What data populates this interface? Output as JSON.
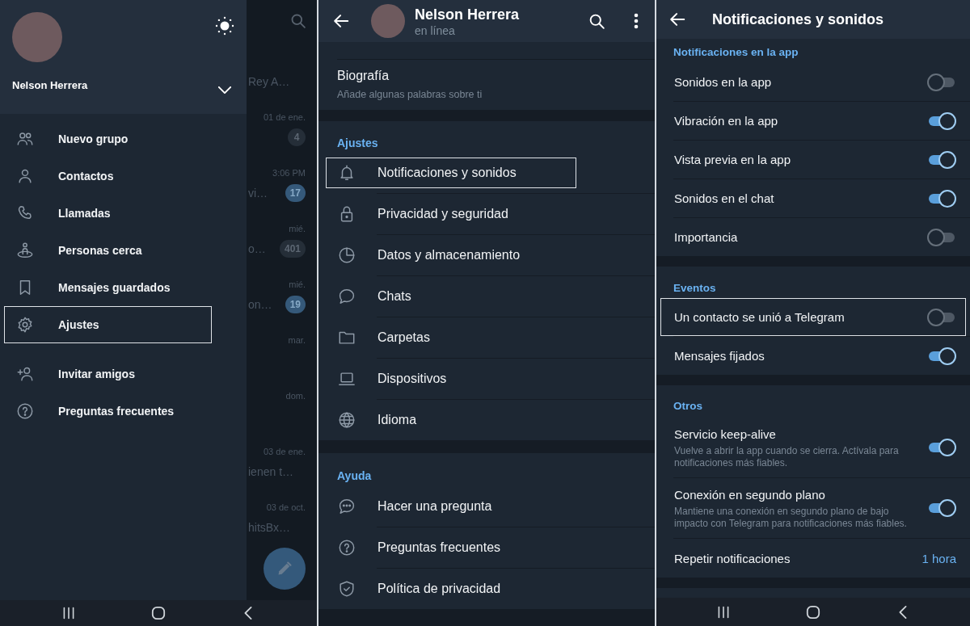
{
  "drawer_screen": {
    "chat_list": {
      "rows": [
        {
          "preview": "Rey A…"
        },
        {
          "time": "01 de ene.",
          "badge": {
            "count": "4",
            "muted": true
          }
        },
        {
          "time": "3:06 PM",
          "preview": "vi…",
          "badge": {
            "count": "17",
            "muted": false
          }
        },
        {
          "time": "mié.",
          "preview": "o…",
          "badge": {
            "count": "401",
            "muted": true
          }
        },
        {
          "time": "mié.",
          "preview": "on…",
          "badge": {
            "count": "19",
            "muted": false
          }
        },
        {
          "time": "mar."
        },
        {
          "time": "dom."
        },
        {
          "time": "03 de ene.",
          "preview": "ienen t…"
        },
        {
          "time": "03 de oct.",
          "preview": "hitsBx…"
        }
      ]
    },
    "drawer": {
      "user_name": "Nelson Herrera",
      "menu_groups": [
        {
          "items": [
            {
              "label": "Nuevo grupo",
              "highlighted": false
            },
            {
              "label": "Contactos",
              "highlighted": false
            },
            {
              "label": "Llamadas",
              "highlighted": false
            },
            {
              "label": "Personas cerca",
              "highlighted": false
            },
            {
              "label": "Mensajes guardados",
              "highlighted": false
            },
            {
              "label": "Ajustes",
              "highlighted": true
            }
          ]
        },
        {
          "items": [
            {
              "label": "Invitar amigos",
              "highlighted": false
            },
            {
              "label": "Preguntas frecuentes",
              "highlighted": false
            }
          ]
        }
      ]
    }
  },
  "settings_screen": {
    "header": {
      "name": "Nelson Herrera",
      "status": "en línea"
    },
    "bio": {
      "label": "Biografía",
      "subtitle": "Añade algunas palabras sobre ti"
    },
    "sections": [
      {
        "title": "Ajustes",
        "items": [
          {
            "label": "Notificaciones y sonidos",
            "highlighted": true
          },
          {
            "label": "Privacidad y seguridad",
            "highlighted": false
          },
          {
            "label": "Datos y almacenamiento",
            "highlighted": false
          },
          {
            "label": "Chats",
            "highlighted": false
          },
          {
            "label": "Carpetas",
            "highlighted": false
          },
          {
            "label": "Dispositivos",
            "highlighted": false
          },
          {
            "label": "Idioma",
            "highlighted": false
          }
        ]
      },
      {
        "title": "Ayuda",
        "items": [
          {
            "label": "Hacer una pregunta",
            "highlighted": false
          },
          {
            "label": "Preguntas frecuentes",
            "highlighted": false
          },
          {
            "label": "Política de privacidad",
            "highlighted": false
          }
        ]
      }
    ]
  },
  "notifications_screen": {
    "title": "Notificaciones y sonidos",
    "sections": [
      {
        "title": "Notificaciones en la app",
        "items": [
          {
            "kind": "toggle",
            "label": "Sonidos en la app",
            "on": false,
            "highlighted": false
          },
          {
            "kind": "toggle",
            "label": "Vibración en la app",
            "on": true,
            "highlighted": false
          },
          {
            "kind": "toggle",
            "label": "Vista previa en la app",
            "on": true,
            "highlighted": false
          },
          {
            "kind": "toggle",
            "label": "Sonidos en el chat",
            "on": true,
            "highlighted": false
          },
          {
            "kind": "toggle",
            "label": "Importancia",
            "on": false,
            "highlighted": false
          }
        ]
      },
      {
        "title": "Eventos",
        "items": [
          {
            "kind": "toggle",
            "label": "Un contacto se unió a Telegram",
            "on": false,
            "highlighted": true
          },
          {
            "kind": "toggle",
            "label": "Mensajes fijados",
            "on": true,
            "highlighted": false
          }
        ]
      },
      {
        "title": "Otros",
        "items": [
          {
            "kind": "toggle",
            "label": "Servicio keep-alive",
            "description": "Vuelve a abrir la app cuando se cierra. Actívala para notificaciones más fiables.",
            "on": true,
            "highlighted": false
          },
          {
            "kind": "toggle",
            "label": "Conexión en segundo plano",
            "description": "Mantiene una conexión en segundo plano de bajo impacto con Telegram para notificaciones más fiables.",
            "on": true,
            "highlighted": false
          },
          {
            "kind": "value",
            "label": "Repetir notificaciones",
            "value": "1 hora",
            "highlighted": false
          }
        ]
      }
    ]
  }
}
